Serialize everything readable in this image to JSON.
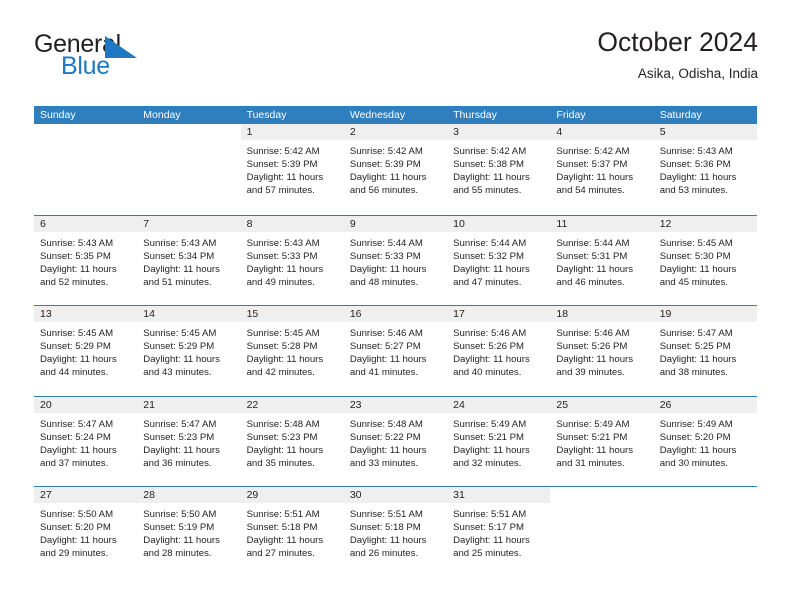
{
  "brand": {
    "name_part1": "General",
    "name_part2": "Blue",
    "flag_icon": "flag-triangle-icon",
    "accent_color": "#1f78c1"
  },
  "header": {
    "title": "October 2024",
    "location": "Asika, Odisha, India"
  },
  "colors": {
    "header_band": "#2f7ebd",
    "daynum_band": "#efefef",
    "row_divider": "#2f7ebd",
    "text": "#231f20"
  },
  "weekday_headers": [
    "Sunday",
    "Monday",
    "Tuesday",
    "Wednesday",
    "Thursday",
    "Friday",
    "Saturday"
  ],
  "weeks": [
    [
      {
        "empty": true
      },
      {
        "empty": true
      },
      {
        "day": "1",
        "sunrise": "Sunrise: 5:42 AM",
        "sunset": "Sunset: 5:39 PM",
        "daylight1": "Daylight: 11 hours",
        "daylight2": "and 57 minutes."
      },
      {
        "day": "2",
        "sunrise": "Sunrise: 5:42 AM",
        "sunset": "Sunset: 5:39 PM",
        "daylight1": "Daylight: 11 hours",
        "daylight2": "and 56 minutes."
      },
      {
        "day": "3",
        "sunrise": "Sunrise: 5:42 AM",
        "sunset": "Sunset: 5:38 PM",
        "daylight1": "Daylight: 11 hours",
        "daylight2": "and 55 minutes."
      },
      {
        "day": "4",
        "sunrise": "Sunrise: 5:42 AM",
        "sunset": "Sunset: 5:37 PM",
        "daylight1": "Daylight: 11 hours",
        "daylight2": "and 54 minutes."
      },
      {
        "day": "5",
        "sunrise": "Sunrise: 5:43 AM",
        "sunset": "Sunset: 5:36 PM",
        "daylight1": "Daylight: 11 hours",
        "daylight2": "and 53 minutes."
      }
    ],
    [
      {
        "day": "6",
        "sunrise": "Sunrise: 5:43 AM",
        "sunset": "Sunset: 5:35 PM",
        "daylight1": "Daylight: 11 hours",
        "daylight2": "and 52 minutes."
      },
      {
        "day": "7",
        "sunrise": "Sunrise: 5:43 AM",
        "sunset": "Sunset: 5:34 PM",
        "daylight1": "Daylight: 11 hours",
        "daylight2": "and 51 minutes."
      },
      {
        "day": "8",
        "sunrise": "Sunrise: 5:43 AM",
        "sunset": "Sunset: 5:33 PM",
        "daylight1": "Daylight: 11 hours",
        "daylight2": "and 49 minutes."
      },
      {
        "day": "9",
        "sunrise": "Sunrise: 5:44 AM",
        "sunset": "Sunset: 5:33 PM",
        "daylight1": "Daylight: 11 hours",
        "daylight2": "and 48 minutes."
      },
      {
        "day": "10",
        "sunrise": "Sunrise: 5:44 AM",
        "sunset": "Sunset: 5:32 PM",
        "daylight1": "Daylight: 11 hours",
        "daylight2": "and 47 minutes."
      },
      {
        "day": "11",
        "sunrise": "Sunrise: 5:44 AM",
        "sunset": "Sunset: 5:31 PM",
        "daylight1": "Daylight: 11 hours",
        "daylight2": "and 46 minutes."
      },
      {
        "day": "12",
        "sunrise": "Sunrise: 5:45 AM",
        "sunset": "Sunset: 5:30 PM",
        "daylight1": "Daylight: 11 hours",
        "daylight2": "and 45 minutes."
      }
    ],
    [
      {
        "day": "13",
        "sunrise": "Sunrise: 5:45 AM",
        "sunset": "Sunset: 5:29 PM",
        "daylight1": "Daylight: 11 hours",
        "daylight2": "and 44 minutes."
      },
      {
        "day": "14",
        "sunrise": "Sunrise: 5:45 AM",
        "sunset": "Sunset: 5:29 PM",
        "daylight1": "Daylight: 11 hours",
        "daylight2": "and 43 minutes."
      },
      {
        "day": "15",
        "sunrise": "Sunrise: 5:45 AM",
        "sunset": "Sunset: 5:28 PM",
        "daylight1": "Daylight: 11 hours",
        "daylight2": "and 42 minutes."
      },
      {
        "day": "16",
        "sunrise": "Sunrise: 5:46 AM",
        "sunset": "Sunset: 5:27 PM",
        "daylight1": "Daylight: 11 hours",
        "daylight2": "and 41 minutes."
      },
      {
        "day": "17",
        "sunrise": "Sunrise: 5:46 AM",
        "sunset": "Sunset: 5:26 PM",
        "daylight1": "Daylight: 11 hours",
        "daylight2": "and 40 minutes."
      },
      {
        "day": "18",
        "sunrise": "Sunrise: 5:46 AM",
        "sunset": "Sunset: 5:26 PM",
        "daylight1": "Daylight: 11 hours",
        "daylight2": "and 39 minutes."
      },
      {
        "day": "19",
        "sunrise": "Sunrise: 5:47 AM",
        "sunset": "Sunset: 5:25 PM",
        "daylight1": "Daylight: 11 hours",
        "daylight2": "and 38 minutes."
      }
    ],
    [
      {
        "day": "20",
        "sunrise": "Sunrise: 5:47 AM",
        "sunset": "Sunset: 5:24 PM",
        "daylight1": "Daylight: 11 hours",
        "daylight2": "and 37 minutes."
      },
      {
        "day": "21",
        "sunrise": "Sunrise: 5:47 AM",
        "sunset": "Sunset: 5:23 PM",
        "daylight1": "Daylight: 11 hours",
        "daylight2": "and 36 minutes."
      },
      {
        "day": "22",
        "sunrise": "Sunrise: 5:48 AM",
        "sunset": "Sunset: 5:23 PM",
        "daylight1": "Daylight: 11 hours",
        "daylight2": "and 35 minutes."
      },
      {
        "day": "23",
        "sunrise": "Sunrise: 5:48 AM",
        "sunset": "Sunset: 5:22 PM",
        "daylight1": "Daylight: 11 hours",
        "daylight2": "and 33 minutes."
      },
      {
        "day": "24",
        "sunrise": "Sunrise: 5:49 AM",
        "sunset": "Sunset: 5:21 PM",
        "daylight1": "Daylight: 11 hours",
        "daylight2": "and 32 minutes."
      },
      {
        "day": "25",
        "sunrise": "Sunrise: 5:49 AM",
        "sunset": "Sunset: 5:21 PM",
        "daylight1": "Daylight: 11 hours",
        "daylight2": "and 31 minutes."
      },
      {
        "day": "26",
        "sunrise": "Sunrise: 5:49 AM",
        "sunset": "Sunset: 5:20 PM",
        "daylight1": "Daylight: 11 hours",
        "daylight2": "and 30 minutes."
      }
    ],
    [
      {
        "day": "27",
        "sunrise": "Sunrise: 5:50 AM",
        "sunset": "Sunset: 5:20 PM",
        "daylight1": "Daylight: 11 hours",
        "daylight2": "and 29 minutes."
      },
      {
        "day": "28",
        "sunrise": "Sunrise: 5:50 AM",
        "sunset": "Sunset: 5:19 PM",
        "daylight1": "Daylight: 11 hours",
        "daylight2": "and 28 minutes."
      },
      {
        "day": "29",
        "sunrise": "Sunrise: 5:51 AM",
        "sunset": "Sunset: 5:18 PM",
        "daylight1": "Daylight: 11 hours",
        "daylight2": "and 27 minutes."
      },
      {
        "day": "30",
        "sunrise": "Sunrise: 5:51 AM",
        "sunset": "Sunset: 5:18 PM",
        "daylight1": "Daylight: 11 hours",
        "daylight2": "and 26 minutes."
      },
      {
        "day": "31",
        "sunrise": "Sunrise: 5:51 AM",
        "sunset": "Sunset: 5:17 PM",
        "daylight1": "Daylight: 11 hours",
        "daylight2": "and 25 minutes."
      },
      {
        "empty": true
      },
      {
        "empty": true
      }
    ]
  ]
}
